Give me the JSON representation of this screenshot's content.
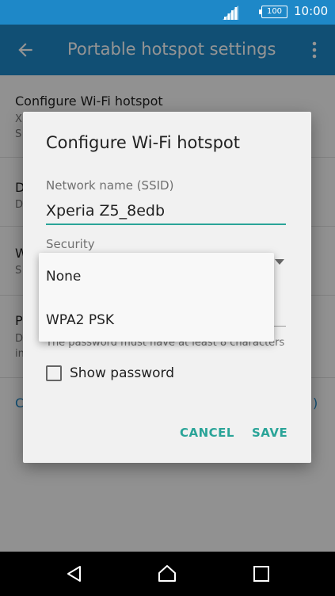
{
  "status_bar": {
    "battery": "100",
    "time": "10:00"
  },
  "app_bar": {
    "title": "Portable hotspot settings"
  },
  "background_list": {
    "rows": [
      {
        "title": "Configure Wi-Fi hotspot",
        "subtitle_a": "X",
        "subtitle_b": "S"
      },
      {
        "title": "D",
        "subtitle": "D"
      },
      {
        "title": "W",
        "subtitle": "S"
      },
      {
        "title": "P",
        "subtitle": "D",
        "subtitle_b": "in"
      },
      {
        "title": "C",
        "trailing": ")"
      }
    ]
  },
  "dialog": {
    "title": "Configure Wi-Fi hotspot",
    "ssid_label": "Network name (SSID)",
    "ssid_value": "Xperia Z5_8edb",
    "security_label": "Security",
    "password_hint": "The password must have at least 8 characters",
    "show_password_label": "Show password",
    "cancel_label": "CANCEL",
    "save_label": "SAVE"
  },
  "security_dropdown": {
    "options": [
      "None",
      "WPA2 PSK"
    ]
  },
  "colors": {
    "primary": "#1e88c8",
    "accent": "#2aa498"
  },
  "icons": {
    "back": "arrow-left-icon",
    "menu": "more-vert-icon",
    "signal": "signal-icon",
    "battery": "battery-icon",
    "nav_back": "triangle-back-icon",
    "nav_home": "circle-home-icon",
    "nav_recent": "square-recent-icon"
  }
}
